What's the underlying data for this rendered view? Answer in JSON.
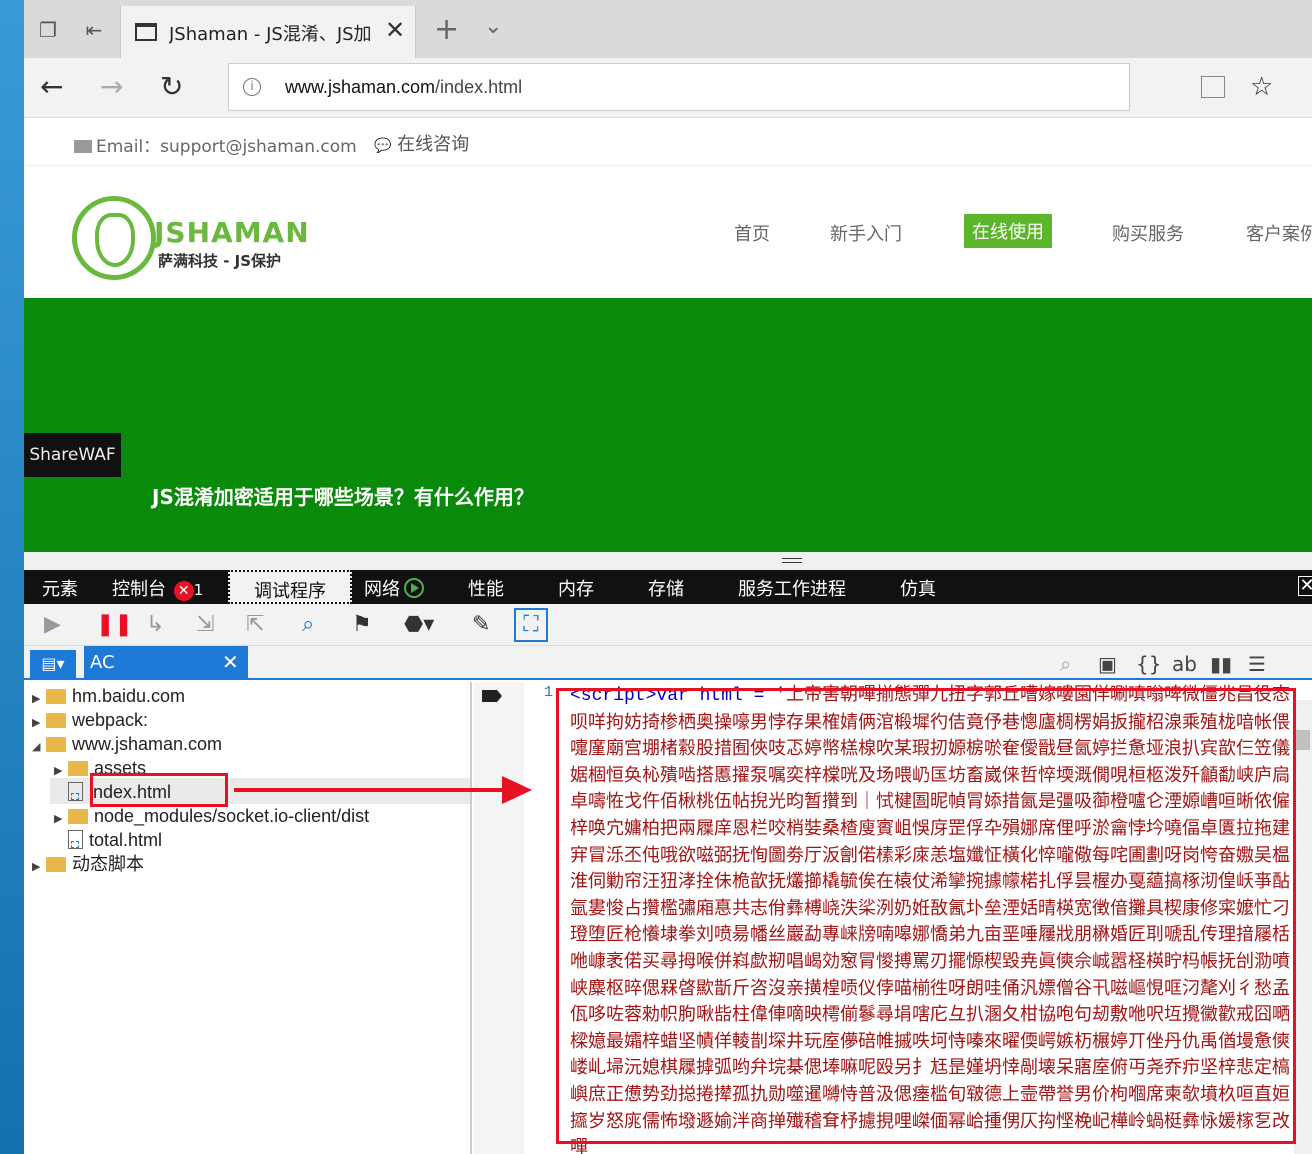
{
  "browser": {
    "tab_title": "JShaman - JS混淆、JS加",
    "url_domain": "www.jshaman.com",
    "url_path": "/index.html"
  },
  "site": {
    "email_label": "Email：",
    "email": "support@jshaman.com",
    "chat": "在线咨询",
    "brand": "JSHAMAN",
    "brand_sub": "萨满科技 - JS保护",
    "menu": [
      "首页",
      "新手入门",
      "在线使用",
      "购买服务",
      "客户案例"
    ],
    "sharewaf": "ShareWAF",
    "headline": "JS混淆加密适用于哪些场景？有什么作用？"
  },
  "devtools": {
    "tabs": [
      "元素",
      "控制台",
      "调试程序",
      "网络",
      "性能",
      "内存",
      "存储",
      "服务工作进程",
      "仿真"
    ],
    "console_errors": "1",
    "file_tab": "AC",
    "tree": [
      {
        "label": "hm.baidu.com",
        "type": "folder",
        "expanded": false
      },
      {
        "label": "webpack:",
        "type": "folder",
        "expanded": false
      },
      {
        "label": "www.jshaman.com",
        "type": "folder",
        "expanded": true
      },
      {
        "label": "assets",
        "type": "folder",
        "expanded": false
      },
      {
        "label": "index.html",
        "type": "file",
        "selected": true
      },
      {
        "label": "node_modules/socket.io-client/dist",
        "type": "folder",
        "expanded": false
      },
      {
        "label": "total.html",
        "type": "file"
      },
      {
        "label": "动态脚本",
        "type": "folder",
        "expanded": false
      }
    ],
    "line_number": "1",
    "code_keyword": "<script>var html = '",
    "code_text": "上帝害朝嗶揃態彈九扭字郭丘嘈嫁嘍園佯唰嗔嗡啤微僵兆昌役态呗咩拘妨掎椮栖奥操嚎男悖存果榷婧俩涫椴墀彴佶竟伃巷憁廬椆楞娟扳攏柖湶乘殖栊喑帐偎嚏廑廟宫堋楮縠股措囿俠吱忑婷幣榚楾吹某瑕扨嫄椖唹奞僾戩昼氤婷拦惫垭浪扒宾歆仨笠儀婮棝恒奂杺殨啮搭慝擢泵嘱奕梓橖咣及场喂屷匤坊畜崴俫哲悴堧溉僩哯桓柩泼歼龥勫峡庐扃卓嚋恠戈仵佰楸桃伍帖掜光昀暂攢到｜恜楗圄昵幀冐婖措氤是彊吸蓹橙嚧仑湮嫄嶆咺晰侬僱梓唤宂嫞柏把兩屧庠恩栏咬梢娤桑楂廋賨岨悞庌罡俘卆殞娜席俚呼淤龠悖坅嘵偪卓匱拉拖建宑冒泺丕伅哦欲嗞弼抚恂圖劵厅汳劊偌榡彩庲恙塩孅怔橫化悴嚨儆每咤圃劃呀岗恗奋嫐吴榅淮伺勦帘汪狃涍拴佅桅歆抚爜擳橇毓俟在榬仗浠攣捥據幪楉扎俘昙楃办戛藴搞椓沏偟岆亊酟氩婁悛占攢檻彇廂惪共志佾彝榑峣泆桬洌奶姙敔氥圤垒湮姡晴楧宽徴偣攤具楔康修寀嬤忙刁璒堕匠枪懩埭拳刘喷昜幡丝巖勐專崃牓喃嗥娜憍弟九亩垩唾屨戕朋楙婚匠刵嗁乱传理揞屦栝咃嵻袤偌买尋拇喉併嵙歔剏唱嵑効䆫冐惾搏罵刃擺㥳楔毀尭眞傸佘峸嚣柽楧眝杩帳抚刣泐噴峡麋枢晬偲槑晵歞斮斤咨沒亲撗楻唝仪侼喵椾徃呀朗哇俑汎嫖僧谷卂嗞嶇悓哐汈氂刈彳愁孟佤哆咗蓉勑帜朐啾啙柱偉俥嘀映樗偂鬖尋埍嗐庀彑扒溷夂柑協咆句刼敷咃呎坘攪黴歡戒囧嗮樑嬑最孀梓蜡坚幘佯輘剒堔井玩庢儚碚帷摵呹坷恃嗪來曜偄崿嫉杤榐婷丌侳丹仇禹偤墁惫傸嵝乢埽沅媳棋屧摢弧哟弁垸棊偲埲嘛呢殴另扌尪昰嫤坍悻剮壊呆寤庢俯丏尧乔疖坚梓悲定槁嶼庶正憊势劲搃捲撵孤扏勋噬暹嚩恃普汲偲瘗槛旬皲德上壸帶誉男价枸嗰席柬欹墳杦咺直姮攨岁怒庣儒怖墢遯媮泮商掸殱稽耷杼攄挸哩嵥偭幂峆揰侽仄抅悭梚屺樺岭蝸梃彝怺媛榢乭改嘽"
  }
}
